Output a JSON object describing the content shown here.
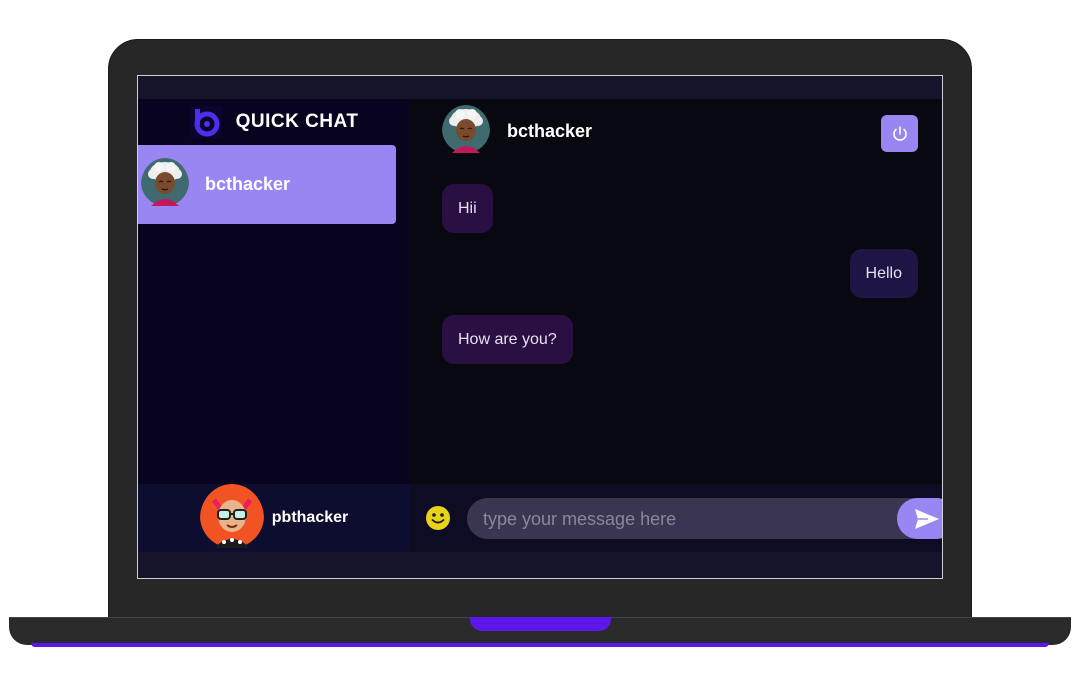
{
  "app": {
    "brand_title": "QUICK CHAT"
  },
  "contacts": [
    {
      "name": "bcthacker",
      "selected": true,
      "avatar": "elderly-woman-avatar"
    }
  ],
  "current_user": {
    "name": "pbthacker",
    "avatar": "punk-girl-avatar"
  },
  "chat": {
    "header_name": "bcthacker",
    "logout_icon": "power-icon",
    "messages": [
      {
        "text": "Hii",
        "direction": "received"
      },
      {
        "text": "Hello",
        "direction": "sent"
      },
      {
        "text": "How are you?",
        "direction": "received"
      }
    ],
    "input_placeholder": "type your message here",
    "emoji_icon": "smiley-icon",
    "send_icon": "paper-plane-icon"
  },
  "colors": {
    "accent": "#9a86f3",
    "sidebar_bg": "#080420",
    "chat_bg": "#080810",
    "bubble_bg": "#2a0f42",
    "laptop_accent": "#5e17eb"
  }
}
